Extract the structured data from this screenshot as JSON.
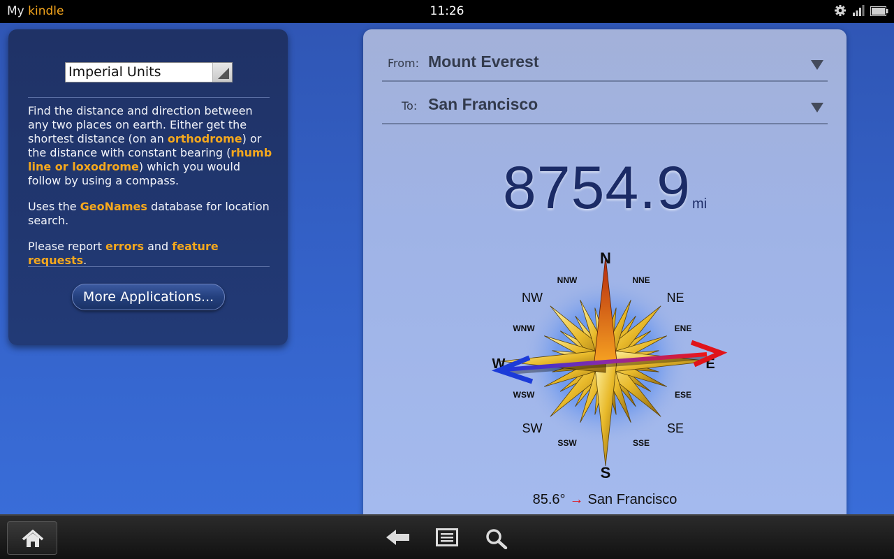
{
  "statusbar": {
    "brand_my": "My",
    "brand_kindle": "kindle",
    "time": "11:26",
    "icons": [
      "gear-icon",
      "wifi-signal-icon",
      "battery-icon"
    ]
  },
  "left_panel": {
    "units_select": {
      "value": "Imperial Units"
    },
    "description": {
      "p1_a": "Find the distance and direction between any two places on earth. Either get the shortest distance (on an ",
      "p1_link1": "orthodrome",
      "p1_b": ") or the distance with constant bearing (",
      "p1_link2": "rhumb line or loxodrome",
      "p1_c": ") which you would follow by using a compass.",
      "p2_a": "Uses the ",
      "p2_link": "GeoNames",
      "p2_b": " database for location search.",
      "p3_a": "Please report ",
      "p3_link1": "errors",
      "p3_b": " and ",
      "p3_link2": "feature requests",
      "p3_c": "."
    },
    "more_button": "More Applications..."
  },
  "right_panel": {
    "from_label": "From:",
    "from_value": "Mount Everest",
    "to_label": "To:",
    "to_value": "San Francisco",
    "distance": "8754.9",
    "distance_unit": "mi",
    "compass": {
      "N": "N",
      "NNE": "NNE",
      "NE": "NE",
      "ENE": "ENE",
      "E": "E",
      "ESE": "ESE",
      "SE": "SE",
      "SSE": "SSE",
      "S": "S",
      "SSW": "SSW",
      "SW": "SW",
      "WSW": "WSW",
      "W": "W",
      "WNW": "WNW",
      "NW": "NW",
      "NNW": "NNW"
    },
    "bearing_value": "85.6°",
    "bearing_arrow": "→",
    "bearing_target": "San Francisco"
  },
  "navbar": {
    "icons": [
      "home-icon",
      "back-icon",
      "menu-icon",
      "search-icon"
    ]
  },
  "colors": {
    "accent_link": "#f5a81d",
    "kindle_orange": "#f4a51c",
    "distance_text": "#1b2b66",
    "arrow_red": "#e0141a",
    "arrow_blue": "#1c3bd8"
  }
}
